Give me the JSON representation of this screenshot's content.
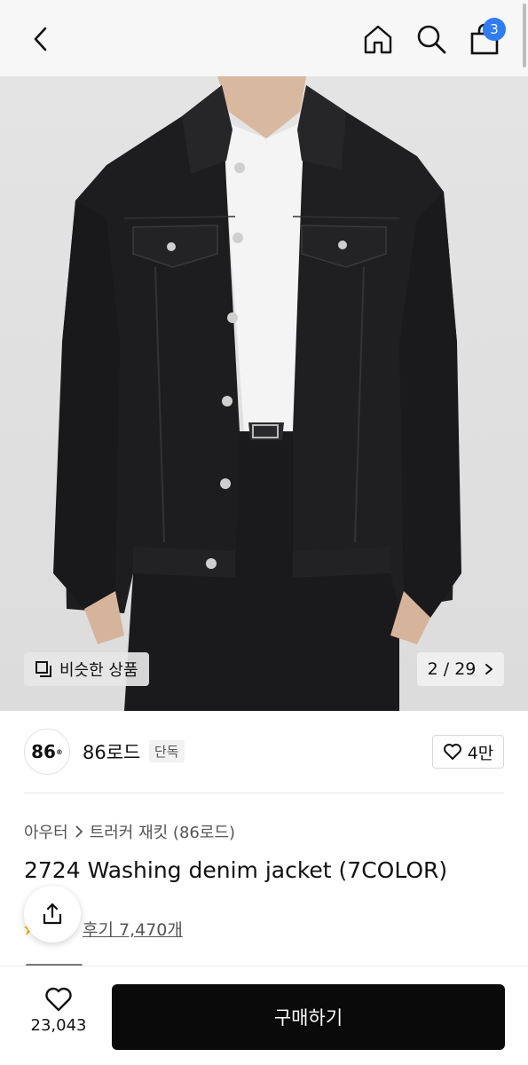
{
  "header": {
    "icons": [
      "chevron-left-icon",
      "home-icon",
      "search-icon",
      "bag-icon"
    ],
    "cart_count": "3"
  },
  "gallery": {
    "similar_label": "비슷한 상품",
    "page_current": "2",
    "page_separator": "/",
    "page_total": "29"
  },
  "brand": {
    "logo_text": "86",
    "logo_mark": "®",
    "name": "86로드",
    "tag": "단독",
    "likes": "4만"
  },
  "product": {
    "category": "아우터",
    "subcategory": "트러커 재킷 (86로드)",
    "title": "2724 Washing denim jacket (7COLOR)",
    "reviews": "후기 7,470개"
  },
  "bottom": {
    "wish_count": "23,043",
    "buy_label": "구매하기"
  },
  "colors": {
    "badge": "#2e7cf6",
    "buy_button": "#0a0a0a",
    "jacket": "#1d1d1f"
  }
}
